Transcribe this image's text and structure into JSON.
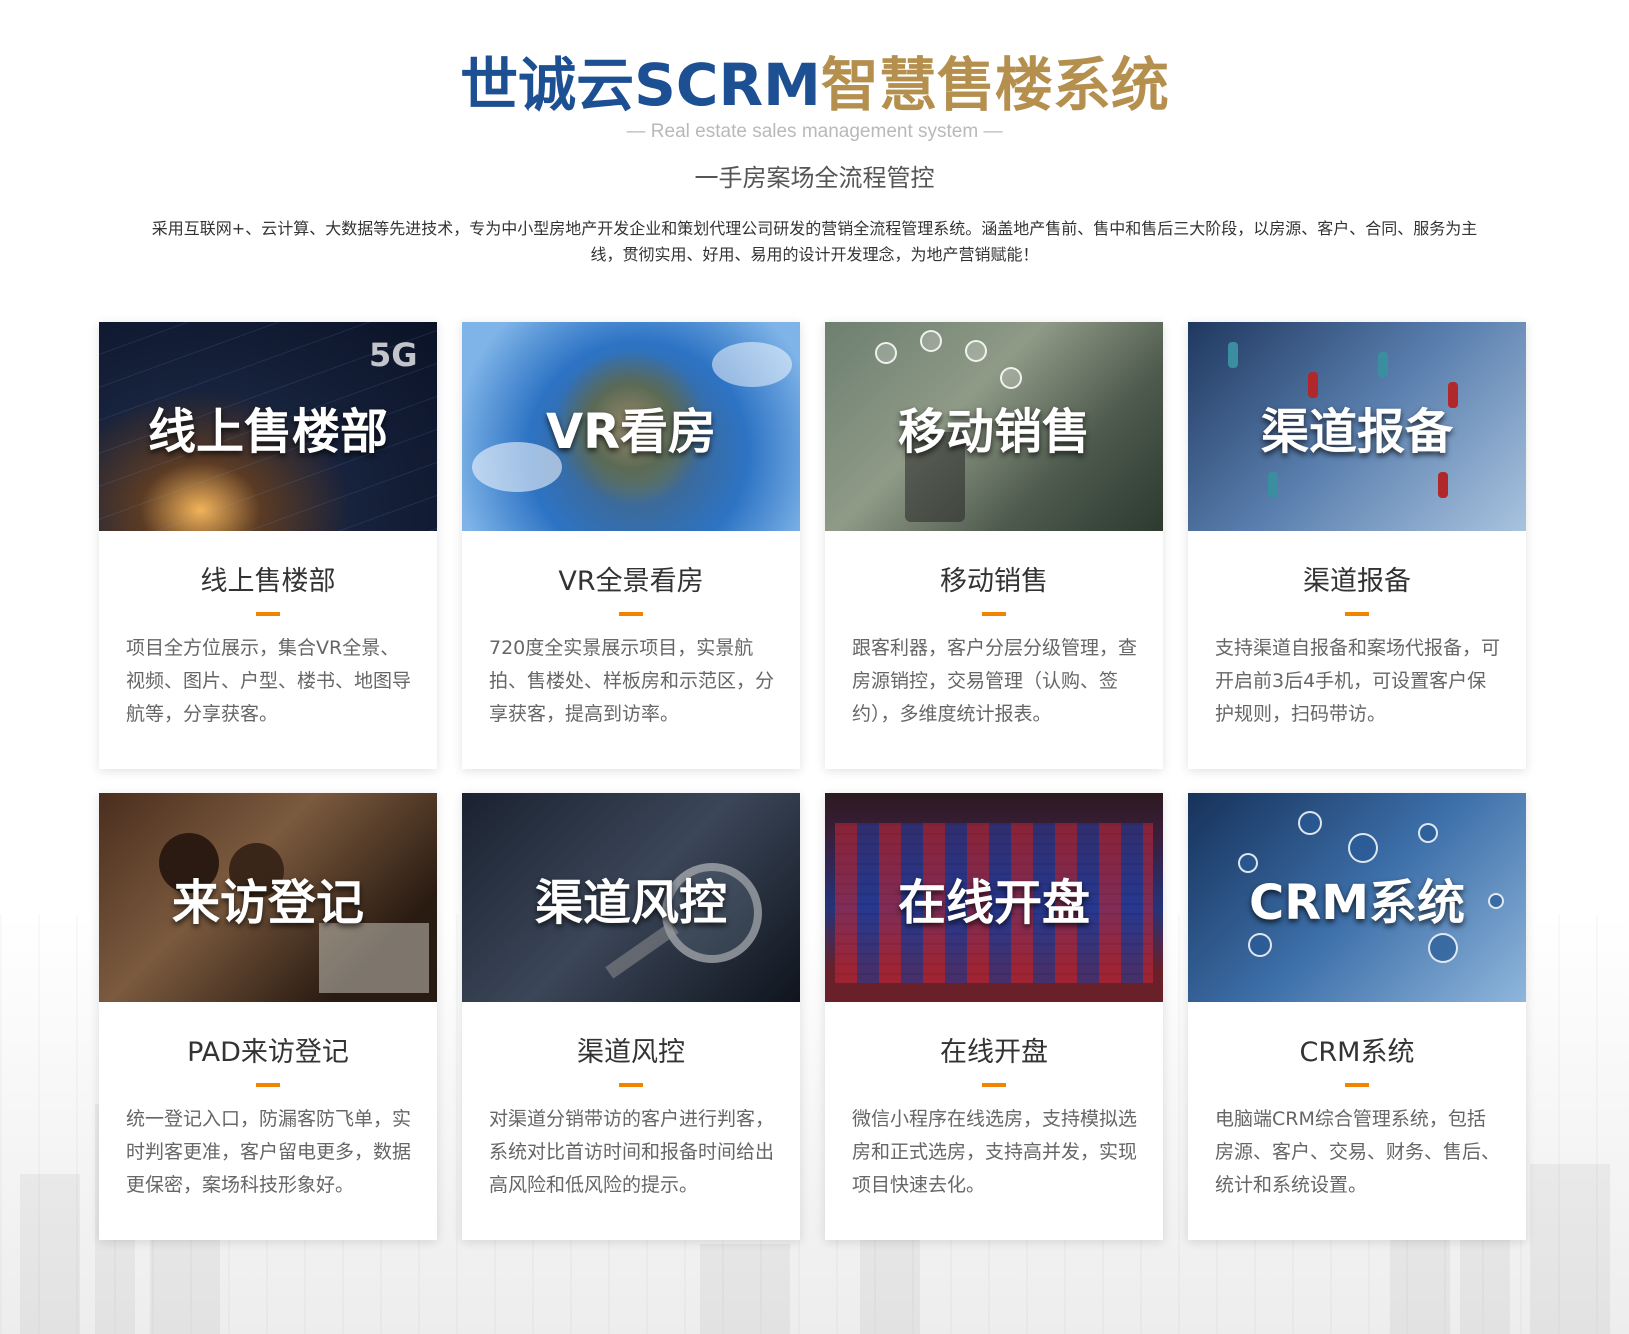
{
  "header": {
    "title_part1": "世诚云SCRM",
    "title_part2": "智慧售楼系统",
    "subtitle_en": "— Real estate sales management system —",
    "tagline": "一手房案场全流程管控",
    "description": "采用互联网+、云计算、大数据等先进技术，专为中小型房地产开发企业和策划代理公司研发的营销全流程管理系统。涵盖地产售前、售中和售后三大阶段，以房源、客户、合同、服务为主线，贯彻实用、好用、易用的设计开发理念，为地产营销赋能！"
  },
  "cards": [
    {
      "banner_text": "线上售楼部",
      "badge": "5G",
      "title": "线上售楼部",
      "desc": "项目全方位展示，集合VR全景、视频、图片、户型、楼书、地图导航等，分享获客。"
    },
    {
      "banner_text": "VR看房",
      "title": "VR全景看房",
      "desc": "720度全实景展示项目，实景航拍、售楼处、样板房和示范区，分享获客，提高到访率。"
    },
    {
      "banner_text": "移动销售",
      "title": "移动销售",
      "desc": "跟客利器，客户分层分级管理，查房源销控，交易管理（认购、签约），多维度统计报表。"
    },
    {
      "banner_text": "渠道报备",
      "title": "渠道报备",
      "desc": "支持渠道自报备和案场代报备，可开启前3后4手机，可设置客户保护规则，扫码带访。"
    },
    {
      "banner_text": "来访登记",
      "title": "PAD来访登记",
      "desc": "统一登记入口，防漏客防飞单，实时判客更准，客户留电更多，数据更保密，案场科技形象好。"
    },
    {
      "banner_text": "渠道风控",
      "title": "渠道风控",
      "desc": "对渠道分销带访的客户进行判客，系统对比首访时间和报备时间给出高风险和低风险的提示。"
    },
    {
      "banner_text": "在线开盘",
      "title": "在线开盘",
      "desc": "微信小程序在线选房，支持模拟选房和正式选房，支持高并发，实现项目快速去化。"
    },
    {
      "banner_text": "CRM系统",
      "title": "CRM系统",
      "desc": "电脑端CRM综合管理系统，包括房源、客户、交易、财务、售后、统计和系统设置。"
    }
  ],
  "colors": {
    "title_blue": "#1d4f93",
    "title_gold": "#b58f4e",
    "accent_orange": "#f08300"
  }
}
